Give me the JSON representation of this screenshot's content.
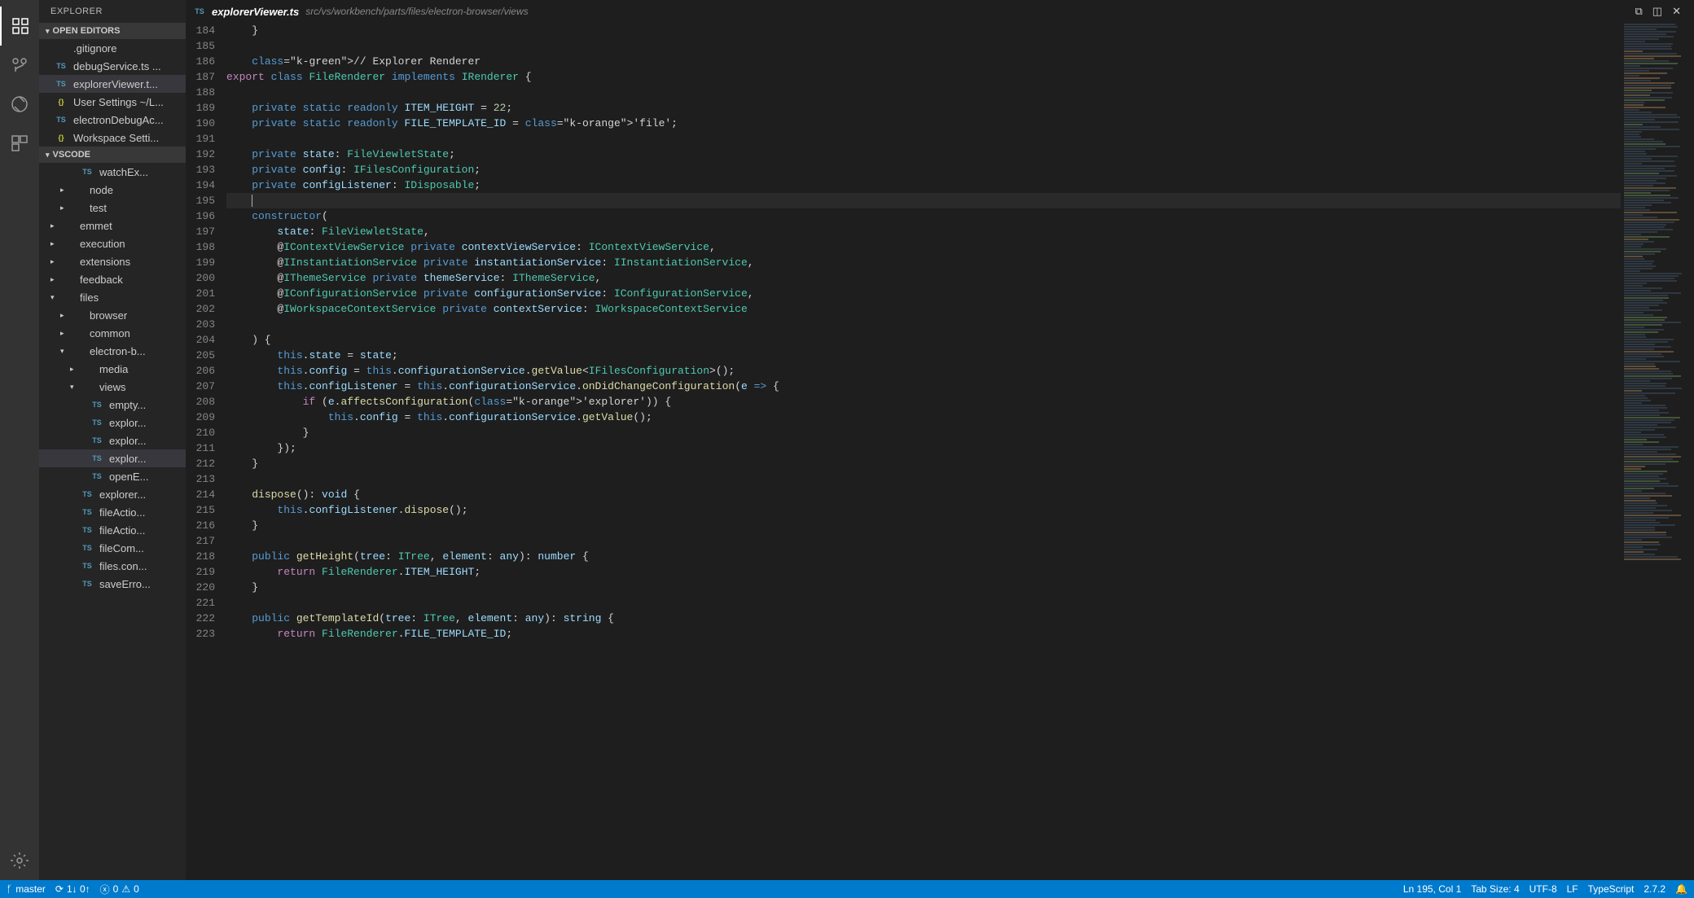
{
  "sidebar": {
    "title": "EXPLORER",
    "openEditorsLabel": "OPEN EDITORS",
    "workspaceLabel": "VSCODE",
    "openEditors": [
      {
        "badge": "",
        "badgeClass": "",
        "name": ".gitignore",
        "active": false
      },
      {
        "badge": "TS",
        "badgeClass": "badge-ts",
        "name": "debugService.ts ...",
        "active": false
      },
      {
        "badge": "TS",
        "badgeClass": "badge-ts",
        "name": "explorerViewer.t...",
        "active": true
      },
      {
        "badge": "{}",
        "badgeClass": "badge-json",
        "name": "User Settings ~/L...",
        "active": false
      },
      {
        "badge": "TS",
        "badgeClass": "badge-ts",
        "name": "electronDebugAc...",
        "active": false
      },
      {
        "badge": "{}",
        "badgeClass": "badge-json",
        "name": "Workspace Setti...",
        "active": false
      }
    ],
    "tree": [
      {
        "indent": 2,
        "chev": "",
        "badge": "TS",
        "badgeClass": "badge-ts",
        "name": "watchEx...",
        "active": false
      },
      {
        "indent": 1,
        "chev": "▸",
        "badge": "",
        "badgeClass": "",
        "name": "node",
        "active": false
      },
      {
        "indent": 1,
        "chev": "▸",
        "badge": "",
        "badgeClass": "",
        "name": "test",
        "active": false
      },
      {
        "indent": 0,
        "chev": "▸",
        "badge": "",
        "badgeClass": "",
        "name": "emmet",
        "active": false
      },
      {
        "indent": 0,
        "chev": "▸",
        "badge": "",
        "badgeClass": "",
        "name": "execution",
        "active": false
      },
      {
        "indent": 0,
        "chev": "▸",
        "badge": "",
        "badgeClass": "",
        "name": "extensions",
        "active": false
      },
      {
        "indent": 0,
        "chev": "▸",
        "badge": "",
        "badgeClass": "",
        "name": "feedback",
        "active": false
      },
      {
        "indent": 0,
        "chev": "▾",
        "badge": "",
        "badgeClass": "",
        "name": "files",
        "active": false
      },
      {
        "indent": 1,
        "chev": "▸",
        "badge": "",
        "badgeClass": "",
        "name": "browser",
        "active": false
      },
      {
        "indent": 1,
        "chev": "▸",
        "badge": "",
        "badgeClass": "",
        "name": "common",
        "active": false
      },
      {
        "indent": 1,
        "chev": "▾",
        "badge": "",
        "badgeClass": "",
        "name": "electron-b...",
        "active": false
      },
      {
        "indent": 2,
        "chev": "▸",
        "badge": "",
        "badgeClass": "",
        "name": "media",
        "active": false
      },
      {
        "indent": 2,
        "chev": "▾",
        "badge": "",
        "badgeClass": "",
        "name": "views",
        "active": false
      },
      {
        "indent": 3,
        "chev": "",
        "badge": "TS",
        "badgeClass": "badge-ts",
        "name": "empty...",
        "active": false
      },
      {
        "indent": 3,
        "chev": "",
        "badge": "TS",
        "badgeClass": "badge-ts",
        "name": "explor...",
        "active": false
      },
      {
        "indent": 3,
        "chev": "",
        "badge": "TS",
        "badgeClass": "badge-ts",
        "name": "explor...",
        "active": false
      },
      {
        "indent": 3,
        "chev": "",
        "badge": "TS",
        "badgeClass": "badge-ts",
        "name": "explor...",
        "active": true
      },
      {
        "indent": 3,
        "chev": "",
        "badge": "TS",
        "badgeClass": "badge-ts",
        "name": "openE...",
        "active": false
      },
      {
        "indent": 2,
        "chev": "",
        "badge": "TS",
        "badgeClass": "badge-ts",
        "name": "explorer...",
        "active": false
      },
      {
        "indent": 2,
        "chev": "",
        "badge": "TS",
        "badgeClass": "badge-ts",
        "name": "fileActio...",
        "active": false
      },
      {
        "indent": 2,
        "chev": "",
        "badge": "TS",
        "badgeClass": "badge-ts",
        "name": "fileActio...",
        "active": false
      },
      {
        "indent": 2,
        "chev": "",
        "badge": "TS",
        "badgeClass": "badge-ts",
        "name": "fileCom...",
        "active": false
      },
      {
        "indent": 2,
        "chev": "",
        "badge": "TS",
        "badgeClass": "badge-ts",
        "name": "files.con...",
        "active": false
      },
      {
        "indent": 2,
        "chev": "",
        "badge": "TS",
        "badgeClass": "badge-ts",
        "name": "saveErro...",
        "active": false
      }
    ]
  },
  "tab": {
    "badge": "TS",
    "title": "explorerViewer.ts",
    "path": "src/vs/workbench/parts/files/electron-browser/views"
  },
  "code": {
    "startLine": 184,
    "currentLine": 195,
    "lines": [
      "    }",
      "",
      "    // Explorer Renderer",
      "export class FileRenderer implements IRenderer {",
      "",
      "    private static readonly ITEM_HEIGHT = 22;",
      "    private static readonly FILE_TEMPLATE_ID = 'file';",
      "",
      "    private state: FileViewletState;",
      "    private config: IFilesConfiguration;",
      "    private configListener: IDisposable;",
      "",
      "    constructor(",
      "        state: FileViewletState,",
      "        @IContextViewService private contextViewService: IContextViewService,",
      "        @IInstantiationService private instantiationService: IInstantiationService,",
      "        @IThemeService private themeService: IThemeService,",
      "        @IConfigurationService private configurationService: IConfigurationService,",
      "        @IWorkspaceContextService private contextService: IWorkspaceContextService",
      "",
      "    ) {",
      "        this.state = state;",
      "        this.config = this.configurationService.getValue<IFilesConfiguration>();",
      "        this.configListener = this.configurationService.onDidChangeConfiguration(e => {",
      "            if (e.affectsConfiguration('explorer')) {",
      "                this.config = this.configurationService.getValue();",
      "            }",
      "        });",
      "    }",
      "",
      "    dispose(): void {",
      "        this.configListener.dispose();",
      "    }",
      "",
      "    public getHeight(tree: ITree, element: any): number {",
      "        return FileRenderer.ITEM_HEIGHT;",
      "    }",
      "",
      "    public getTemplateId(tree: ITree, element: any): string {",
      "        return FileRenderer.FILE_TEMPLATE_ID;"
    ]
  },
  "status": {
    "branch": "master",
    "sync": "1↓ 0↑",
    "errors": "0",
    "warnings": "0",
    "lineCol": "Ln 195, Col 1",
    "tabSize": "Tab Size: 4",
    "encoding": "UTF-8",
    "eol": "LF",
    "lang": "TypeScript",
    "version": "2.7.2"
  }
}
